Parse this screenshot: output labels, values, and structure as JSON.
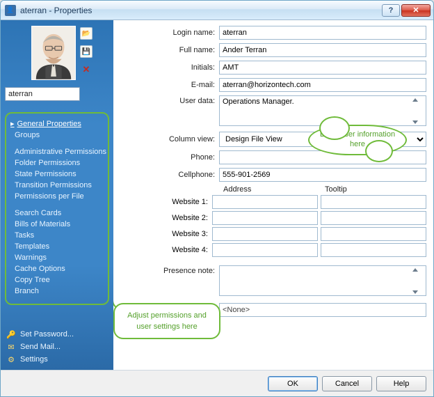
{
  "window": {
    "title": "aterran - Properties"
  },
  "sidebar": {
    "username_value": "aterran",
    "nav": {
      "general_properties": "General Properties",
      "groups": "Groups",
      "admin_permissions": "Administrative Permissions",
      "folder_permissions": "Folder Permissions",
      "state_permissions": "State Permissions",
      "transition_permissions": "Transition Permissions",
      "permissions_per_file": "Permissions per File",
      "search_cards": "Search Cards",
      "bom": "Bills of Materials",
      "tasks": "Tasks",
      "templates": "Templates",
      "warnings": "Warnings",
      "cache_options": "Cache Options",
      "copy_tree": "Copy Tree",
      "branch": "Branch"
    },
    "bottom": {
      "set_password": "Set Password...",
      "send_mail": "Send Mail...",
      "settings": "Settings"
    }
  },
  "form": {
    "labels": {
      "login_name": "Login name:",
      "full_name": "Full name:",
      "initials": "Initials:",
      "email": "E-mail:",
      "user_data": "User data:",
      "column_view": "Column view:",
      "phone": "Phone:",
      "cellphone": "Cellphone:",
      "website1": "Website 1:",
      "website2": "Website 2:",
      "website3": "Website 3:",
      "website4": "Website 4:",
      "presence_note": "Presence note:",
      "address_header": "Address",
      "tooltip_header": "Tooltip"
    },
    "values": {
      "login_name": "aterran",
      "full_name": "Ander Terran",
      "initials": "AMT",
      "email": "aterran@horizontech.com",
      "user_data": "Operations Manager.",
      "column_view": "Design File View",
      "phone": "",
      "cellphone": "555-901-2569",
      "w1a": "",
      "w1b": "",
      "w2a": "",
      "w2b": "",
      "w3a": "",
      "w3b": "",
      "w4a": "",
      "w4b": "",
      "presence_note": "",
      "none_field": "<None>"
    }
  },
  "callouts": {
    "right": "Enter user information here",
    "left": "Adjust permissions and user settings here"
  },
  "buttons": {
    "ok": "OK",
    "cancel": "Cancel",
    "help": "Help"
  }
}
